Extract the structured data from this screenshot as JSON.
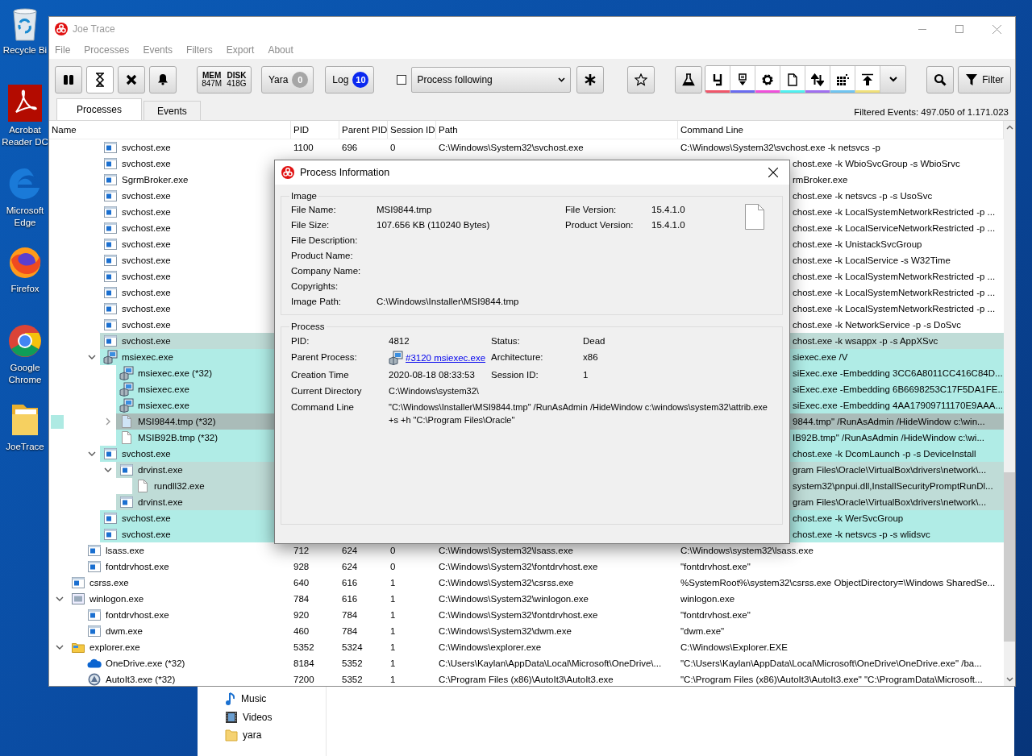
{
  "desktop_icons": [
    {
      "label": "Recycle Bi"
    },
    {
      "label": "Acrobat Reader DC"
    },
    {
      "label": "Microsoft Edge"
    },
    {
      "label": "Firefox"
    },
    {
      "label": "Google Chrome"
    },
    {
      "label": "JoeTrace"
    }
  ],
  "explorer_window": {
    "nav_items": [
      {
        "label": "Music"
      },
      {
        "label": "Videos"
      },
      {
        "label": "yara"
      }
    ]
  },
  "window": {
    "title": "Joe Trace"
  },
  "menu": [
    "File",
    "Processes",
    "Events",
    "Filters",
    "Export",
    "About"
  ],
  "toolbar": {
    "control_buttons": [
      {
        "on": false
      },
      {
        "on": true
      },
      {
        "on": false
      },
      {
        "on": false
      }
    ],
    "memory": {
      "mem_label": "MEM",
      "mem_value": "847M",
      "disk_label": "DISK",
      "disk_value": "418G"
    },
    "counters": [
      {
        "label": "Yara",
        "count": "0",
        "color": "#a6a6a6"
      },
      {
        "label": "Log",
        "count": "10",
        "color": "#0a28f0"
      }
    ],
    "process_following": {
      "checked": false,
      "value": "Process following"
    },
    "category_buttons": [
      {
        "on": true,
        "color": "#f0566a"
      },
      {
        "on": true,
        "color": "#6a6cf0"
      },
      {
        "on": true,
        "color": "#f050dc"
      },
      {
        "on": true,
        "color": "#50f0f0"
      },
      {
        "on": true,
        "color": "#a070f0"
      },
      {
        "on": true,
        "color": "#70c4f0"
      },
      {
        "on": true,
        "color": "#f0e07a"
      }
    ],
    "filter_button": "Filter"
  },
  "tabs": [
    {
      "label": "Processes",
      "selected": true
    },
    {
      "label": "Events",
      "selected": false
    }
  ],
  "filtered_events": "Filtered Events: 497.050 of 1.171.023",
  "table": {
    "columns": [
      "Name",
      "PID",
      "Parent PID",
      "Session ID",
      "Path",
      "Command Line"
    ],
    "rows": [
      {
        "children": [
          {
            "children": [
              {
                "name": "svchost.exe",
                "kind": "service",
                "pid": "1100",
                "parent_pid": "696",
                "session_id": "0",
                "path": "C:\\Windows\\System32\\svchost.exe",
                "command_line": "C:\\Windows\\System32\\svchost.exe -k netsvcs -p"
              },
              {
                "name": "svchost.exe",
                "kind": "service",
                "covered": true,
                "command_line": "chost.exe -k WbioSvcGroup -s WbioSrvc"
              },
              {
                "name": "SgrmBroker.exe",
                "kind": "service",
                "covered": true,
                "command_line": "rmBroker.exe"
              },
              {
                "name": "svchost.exe",
                "kind": "service",
                "covered": true,
                "command_line": "chost.exe -k netsvcs -p -s UsoSvc"
              },
              {
                "name": "svchost.exe",
                "kind": "service",
                "covered": true,
                "command_line": "chost.exe -k LocalSystemNetworkRestricted -p ..."
              },
              {
                "name": "svchost.exe",
                "kind": "service",
                "covered": true,
                "command_line": "chost.exe -k LocalServiceNetworkRestricted -p ..."
              },
              {
                "name": "svchost.exe",
                "kind": "service",
                "covered": true,
                "command_line": "chost.exe -k UnistackSvcGroup"
              },
              {
                "name": "svchost.exe",
                "kind": "service",
                "covered": true,
                "command_line": "chost.exe -k LocalService -s W32Time"
              },
              {
                "name": "svchost.exe",
                "kind": "service",
                "covered": true,
                "command_line": "chost.exe -k LocalSystemNetworkRestricted -p ..."
              },
              {
                "name": "svchost.exe",
                "kind": "service",
                "covered": true,
                "command_line": "chost.exe -k LocalSystemNetworkRestricted -p ..."
              },
              {
                "name": "svchost.exe",
                "kind": "service",
                "covered": true,
                "command_line": "chost.exe -k LocalSystemNetworkRestricted -p ..."
              },
              {
                "name": "svchost.exe",
                "kind": "service",
                "covered": true,
                "command_line": "chost.exe -k NetworkService -p -s DoSvc"
              },
              {
                "name": "svchost.exe",
                "kind": "service",
                "covered": true,
                "color": "#bfdcd7",
                "command_line": "chost.exe -k wsappx -p -s AppXSvc"
              },
              {
                "name": "msiexec.exe",
                "kind": "installer",
                "covered": true,
                "color": "#b0ece6",
                "expanded": true,
                "command_line": "siexec.exe /V",
                "children": [
                  {
                    "name": "msiexec.exe (*32)",
                    "kind": "installer",
                    "covered": true,
                    "color": "#b0ece6",
                    "command_line": "siExec.exe -Embedding 3CC6A8011CC416C84D..."
                  },
                  {
                    "name": "msiexec.exe",
                    "kind": "installer",
                    "covered": true,
                    "color": "#b0ece6",
                    "command_line": "siExec.exe -Embedding 6B6698253C17F5DA1FE..."
                  },
                  {
                    "name": "msiexec.exe",
                    "kind": "installer",
                    "covered": true,
                    "color": "#b0ece6",
                    "command_line": "siExec.exe -Embedding 4AA17909711170E9AAA..."
                  },
                  {
                    "name": "MSI9844.tmp (*32)",
                    "kind": "file",
                    "covered": true,
                    "color": "#aabcb9",
                    "marker": true,
                    "expanded": false,
                    "command_line": "9844.tmp\" /RunAsAdmin /HideWindow c:\\win..."
                  },
                  {
                    "name": "MSIB92B.tmp (*32)",
                    "kind": "file",
                    "covered": true,
                    "color": "#b0ece6",
                    "command_line": "IB92B.tmp\" /RunAsAdmin /HideWindow c:\\wi..."
                  }
                ]
              },
              {
                "name": "svchost.exe",
                "kind": "service",
                "covered": true,
                "color": "#b0ece6",
                "expanded": true,
                "command_line": "chost.exe -k DcomLaunch -p -s DeviceInstall",
                "children": [
                  {
                    "name": "drvinst.exe",
                    "kind": "service",
                    "covered": true,
                    "color": "#bfdcd7",
                    "expanded": true,
                    "command_line": "gram Files\\Oracle\\VirtualBox\\drivers\\network\\...",
                    "children": [
                      {
                        "name": "rundll32.exe",
                        "kind": "file",
                        "covered": true,
                        "color": "#bfdcd7",
                        "command_line": "system32\\pnpui.dll,InstallSecurityPromptRunDl..."
                      }
                    ]
                  },
                  {
                    "name": "drvinst.exe",
                    "kind": "service",
                    "covered": true,
                    "color": "#bfdcd7",
                    "command_line": "gram Files\\Oracle\\VirtualBox\\drivers\\network\\..."
                  }
                ]
              },
              {
                "name": "svchost.exe",
                "kind": "service",
                "covered": true,
                "color": "#b0ece6",
                "command_line": "chost.exe -k WerSvcGroup"
              },
              {
                "name": "svchost.exe",
                "kind": "service",
                "covered": true,
                "color": "#b0ece6",
                "command_line": "chost.exe -k netsvcs -p -s wlidsvc"
              }
            ]
          },
          {
            "name": "lsass.exe",
            "kind": "service",
            "pid": "712",
            "parent_pid": "624",
            "session_id": "0",
            "path": "C:\\Windows\\System32\\lsass.exe",
            "command_line": "C:\\Windows\\system32\\lsass.exe"
          },
          {
            "name": "fontdrvhost.exe",
            "kind": "service",
            "pid": "928",
            "parent_pid": "624",
            "session_id": "0",
            "path": "C:\\Windows\\System32\\fontdrvhost.exe",
            "command_line": "\"fontdrvhost.exe\""
          }
        ]
      },
      {
        "name": "csrss.exe",
        "kind": "service",
        "pid": "640",
        "parent_pid": "616",
        "session_id": "1",
        "path": "C:\\Windows\\System32\\csrss.exe",
        "command_line": "%SystemRoot%\\system32\\csrss.exe ObjectDirectory=\\Windows SharedSe..."
      },
      {
        "name": "winlogon.exe",
        "kind": "window",
        "expanded": true,
        "pid": "784",
        "parent_pid": "616",
        "session_id": "1",
        "path": "C:\\Windows\\System32\\winlogon.exe",
        "command_line": "winlogon.exe",
        "children": [
          {
            "name": "fontdrvhost.exe",
            "kind": "service",
            "pid": "920",
            "parent_pid": "784",
            "session_id": "1",
            "path": "C:\\Windows\\System32\\fontdrvhost.exe",
            "command_line": "\"fontdrvhost.exe\""
          },
          {
            "name": "dwm.exe",
            "kind": "service",
            "pid": "460",
            "parent_pid": "784",
            "session_id": "1",
            "path": "C:\\Windows\\System32\\dwm.exe",
            "command_line": "\"dwm.exe\""
          }
        ]
      },
      {
        "name": "explorer.exe",
        "kind": "folder",
        "expanded": true,
        "pid": "5352",
        "parent_pid": "5324",
        "session_id": "1",
        "path": "C:\\Windows\\explorer.exe",
        "command_line": "C:\\Windows\\Explorer.EXE",
        "children": [
          {
            "name": "OneDrive.exe (*32)",
            "kind": "cloud",
            "pid": "8184",
            "parent_pid": "5352",
            "session_id": "1",
            "path": "C:\\Users\\Kaylan\\AppData\\Local\\Microsoft\\OneDrive\\...",
            "command_line": "\"C:\\Users\\Kaylan\\AppData\\Local\\Microsoft\\OneDrive\\OneDrive.exe\" /ba..."
          },
          {
            "name": "AutoIt3.exe (*32)",
            "kind": "autoit",
            "pid": "7200",
            "parent_pid": "5352",
            "session_id": "1",
            "path": "C:\\Program Files (x86)\\AutoIt3\\AutoIt3.exe",
            "command_line": "\"C:\\Program Files (x86)\\AutoIt3\\AutoIt3.exe\" \"C:\\ProgramData\\Microsoft..."
          }
        ]
      }
    ]
  },
  "dialog": {
    "title": "Process Information",
    "image": {
      "title": "Image",
      "fields": [
        {
          "label": "File Name:",
          "value": "MSI9844.tmp"
        },
        {
          "label": "File Size:",
          "value": "107.656 KB (110240 Bytes)"
        },
        {
          "label": "File Description:"
        },
        {
          "label": "Product Name:"
        },
        {
          "label": "Company Name:"
        },
        {
          "label": "Copyrights:"
        },
        {
          "label": "Image Path:",
          "value": "C:\\Windows\\Installer\\MSI9844.tmp"
        }
      ],
      "version_fields": [
        {
          "label": "File Version:",
          "value": "15.4.1.0"
        },
        {
          "label": "Product Version:",
          "value": "15.4.1.0"
        }
      ]
    },
    "process": {
      "title": "Process",
      "fields": [
        {
          "label": "PID:",
          "value": "4812",
          "kind": "text"
        },
        {
          "label": "Status:",
          "value": "Dead",
          "kind": "text"
        },
        {
          "label": "Parent Process:",
          "value": "#3120 msiexec.exe",
          "kind": "link"
        },
        {
          "label": "Architecture:",
          "value": "x86",
          "kind": "text"
        },
        {
          "label": "Creation Time",
          "value": "2020-08-18 08:33:53",
          "kind": "text"
        },
        {
          "label": "Session ID:",
          "value": "1",
          "kind": "text"
        },
        {
          "label": "Current Directory",
          "value": "C:\\Windows\\system32\\",
          "kind": "wide"
        },
        {
          "label": "Command Line",
          "value": "\"C:\\Windows\\Installer\\MSI9844.tmp\" /RunAsAdmin /HideWindow c:\\windows\\system32\\attrib.exe +s +h \"C:\\Program Files\\Oracle\"",
          "kind": "wide"
        }
      ]
    }
  }
}
